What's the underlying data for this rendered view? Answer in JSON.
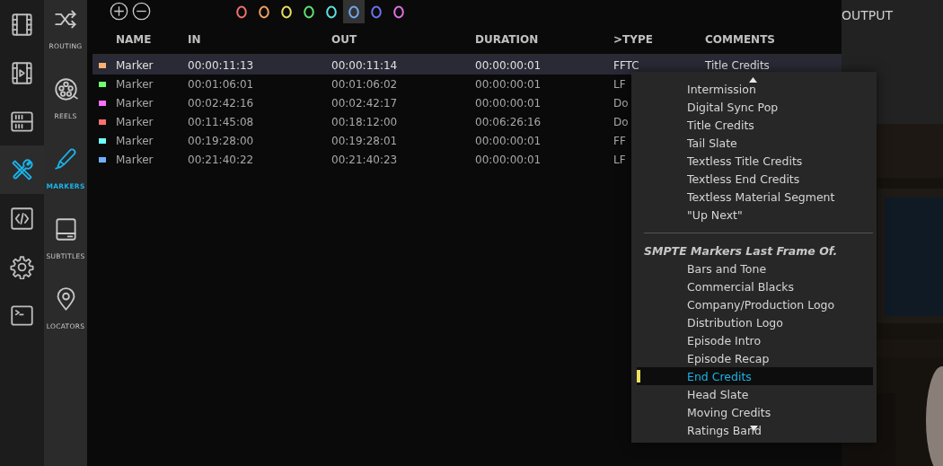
{
  "nav_rail": [
    {
      "selected": false
    },
    {
      "selected": false
    },
    {
      "selected": false
    },
    {
      "selected": true
    },
    {
      "selected": false
    },
    {
      "selected": false
    },
    {
      "selected": false
    }
  ],
  "sub_rail": [
    {
      "label": "ROUTING",
      "selected": false
    },
    {
      "label": "REELS",
      "selected": false
    },
    {
      "label": "MARKERS",
      "selected": true
    },
    {
      "label": "SUBTITLES",
      "selected": false
    },
    {
      "label": "LOCATORS",
      "selected": false
    }
  ],
  "color_filters": [
    {
      "color": "#f07070",
      "selected": false
    },
    {
      "color": "#f0a060",
      "selected": false
    },
    {
      "color": "#e8e060",
      "selected": false
    },
    {
      "color": "#60e070",
      "selected": false
    },
    {
      "color": "#60e0e0",
      "selected": false
    },
    {
      "color": "#70a8f0",
      "selected": true
    },
    {
      "color": "#7070f0",
      "selected": false
    },
    {
      "color": "#e070e0",
      "selected": false
    }
  ],
  "table": {
    "columns": [
      "NAME",
      "IN",
      "OUT",
      "DURATION",
      ">TYPE",
      "COMMENTS"
    ],
    "rows": [
      {
        "color": "#ffb070",
        "selected": true,
        "cells": [
          "Marker",
          "00:00:11:13",
          "00:00:11:14",
          "00:00:00:01",
          "FFTC",
          "Title Credits"
        ]
      },
      {
        "color": "#70ff70",
        "selected": false,
        "cells": [
          "Marker",
          "00:01:06:01",
          "00:01:06:02",
          "00:00:00:01",
          "LF"
        ]
      },
      {
        "color": "#ff70ff",
        "selected": false,
        "cells": [
          "Marker",
          "00:02:42:16",
          "00:02:42:17",
          "00:00:00:01",
          "Do"
        ]
      },
      {
        "color": "#ff7070",
        "selected": false,
        "cells": [
          "Marker",
          "00:11:45:08",
          "00:18:12:00",
          "00:06:26:16",
          "Do"
        ]
      },
      {
        "color": "#70ffff",
        "selected": false,
        "cells": [
          "Marker",
          "00:19:28:00",
          "00:19:28:01",
          "00:00:00:01",
          "FF"
        ]
      },
      {
        "color": "#70b0ff",
        "selected": false,
        "cells": [
          "Marker",
          "00:21:40:22",
          "00:21:40:23",
          "00:00:00:01",
          "LF"
        ]
      }
    ]
  },
  "output_panel": {
    "title": "OUTPUT"
  },
  "type_menu": {
    "entries": [
      {
        "kind": "item",
        "label": "Intermission",
        "selected": false
      },
      {
        "kind": "item",
        "label": "Digital Sync Pop",
        "selected": false
      },
      {
        "kind": "item",
        "label": "Title Credits",
        "selected": false
      },
      {
        "kind": "item",
        "label": "Tail Slate",
        "selected": false
      },
      {
        "kind": "item",
        "label": "Textless Title Credits",
        "selected": false
      },
      {
        "kind": "item",
        "label": "Textless End Credits",
        "selected": false
      },
      {
        "kind": "item",
        "label": "Textless Material Segment",
        "selected": false
      },
      {
        "kind": "item",
        "label": "\"Up Next\"",
        "selected": false
      },
      {
        "kind": "separator"
      },
      {
        "kind": "header",
        "label": "SMPTE Markers Last Frame Of."
      },
      {
        "kind": "item",
        "label": "Bars and Tone",
        "selected": false
      },
      {
        "kind": "item",
        "label": "Commercial Blacks",
        "selected": false
      },
      {
        "kind": "item",
        "label": "Company/Production Logo",
        "selected": false
      },
      {
        "kind": "item",
        "label": "Distribution Logo",
        "selected": false
      },
      {
        "kind": "item",
        "label": "Episode Intro",
        "selected": false
      },
      {
        "kind": "item",
        "label": "Episode Recap",
        "selected": false
      },
      {
        "kind": "item",
        "label": "End Credits",
        "selected": true
      },
      {
        "kind": "item",
        "label": "Head Slate",
        "selected": false
      },
      {
        "kind": "item",
        "label": "Moving Credits",
        "selected": false
      },
      {
        "kind": "item",
        "label": "Ratings Band",
        "selected": false
      }
    ]
  }
}
